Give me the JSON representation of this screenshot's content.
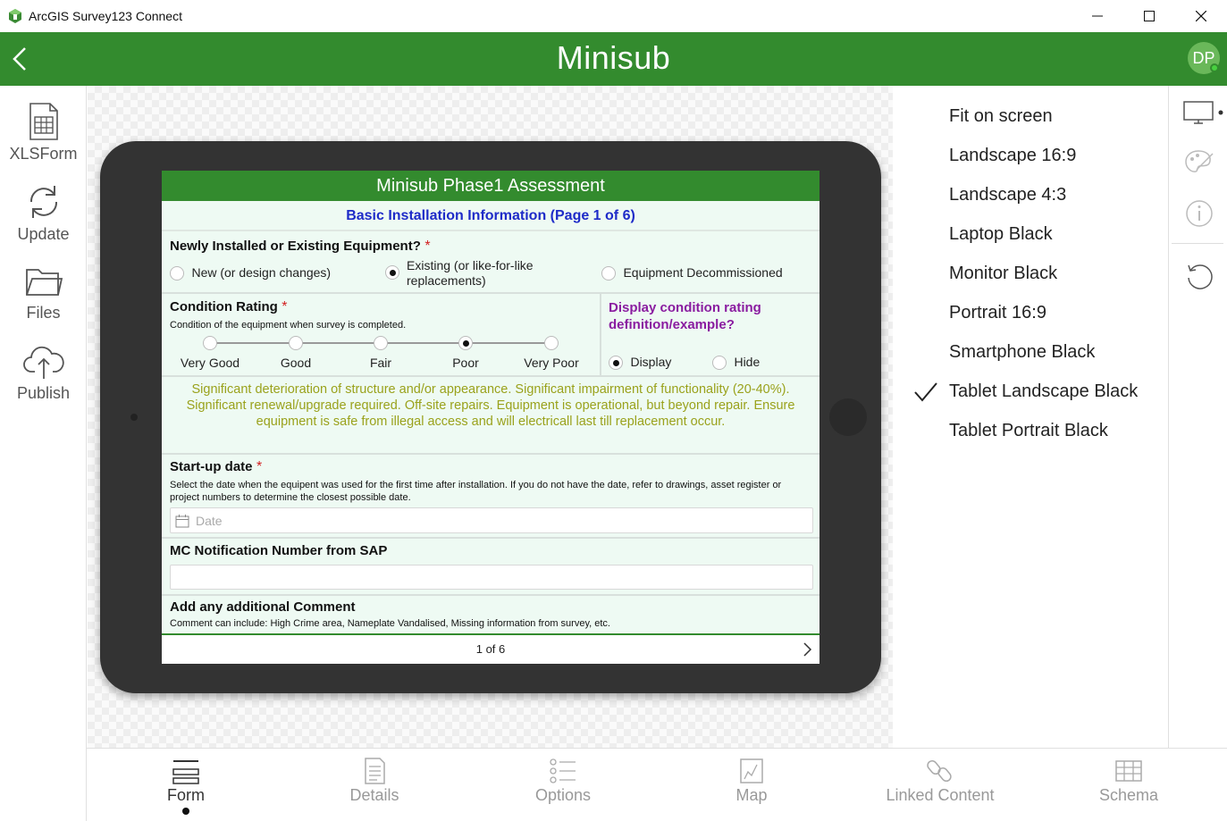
{
  "window": {
    "title": "ArcGIS Survey123 Connect",
    "controls": [
      "minimize",
      "maximize",
      "close"
    ]
  },
  "header": {
    "title": "Minisub",
    "avatar_initials": "DP",
    "color": "#338b2e"
  },
  "sidebar": {
    "items": [
      {
        "label": "XLSForm",
        "icon": "spreadsheet-icon"
      },
      {
        "label": "Update",
        "icon": "refresh-icon"
      },
      {
        "label": "Files",
        "icon": "folder-icon"
      },
      {
        "label": "Publish",
        "icon": "cloud-upload-icon"
      }
    ]
  },
  "form": {
    "title": "Minisub Phase1 Assessment",
    "group_title": "Basic Installation Information (Page 1 of 6)",
    "q1": {
      "label": "Newly Installed or Existing Equipment?",
      "required": "*",
      "options": [
        "New (or design changes)",
        "Existing (or like-for-like replacements)",
        "Equipment Decommissioned"
      ],
      "selected": "Existing (or like-for-like replacements)"
    },
    "q2": {
      "label": "Condition Rating",
      "required": "*",
      "hint": "Condition of the equipment when survey is completed.",
      "options": [
        "Very Good",
        "Good",
        "Fair",
        "Poor",
        "Very Poor"
      ],
      "selected": "Poor"
    },
    "q3": {
      "label": "Display condition rating definition/example?",
      "options": [
        "Display",
        "Hide"
      ],
      "selected": "Display"
    },
    "note": "Significant deterioration of structure and/or appearance. Significant impairment of functionality (20-40%). Significant renewal/upgrade required. Off-site repairs. Equipment is operational, but beyond repair. Ensure equipment is safe from illegal access and will electricall last till replacement occur.",
    "q4": {
      "label": "Start-up date",
      "required": "*",
      "hint": "Select the date when the equipent was used for the first time after installation. If you do not have the date, refer to drawings, asset register or project numbers to determine the closest possible date.",
      "placeholder": "Date"
    },
    "q5": {
      "label": "MC Notification Number from SAP",
      "value": ""
    },
    "q6": {
      "label": "Add any additional Comment",
      "hint": "Comment can include: High Crime area, Nameplate Vandalised, Missing information from survey, etc."
    },
    "pager": "1 of 6",
    "note_color": "#9aa21c",
    "q3_color": "#8a1ca0",
    "group_color": "#1e2bc8"
  },
  "preview_options": {
    "items": [
      "Fit on screen",
      "Landscape 16:9",
      "Landscape 4:3",
      "Laptop Black",
      "Monitor Black",
      "Portrait 16:9",
      "Smartphone Black",
      "Tablet Landscape Black",
      "Tablet Portrait Black"
    ],
    "selected": "Tablet Landscape Black"
  },
  "right_icons": [
    "monitor-icon",
    "palette-icon",
    "info-icon",
    "reload-icon"
  ],
  "tabs": [
    {
      "label": "Form",
      "icon": "form-icon",
      "active": true
    },
    {
      "label": "Details",
      "icon": "details-icon",
      "active": false
    },
    {
      "label": "Options",
      "icon": "options-icon",
      "active": false
    },
    {
      "label": "Map",
      "icon": "map-icon",
      "active": false
    },
    {
      "label": "Linked Content",
      "icon": "link-icon",
      "active": false
    },
    {
      "label": "Schema",
      "icon": "schema-icon",
      "active": false
    }
  ]
}
